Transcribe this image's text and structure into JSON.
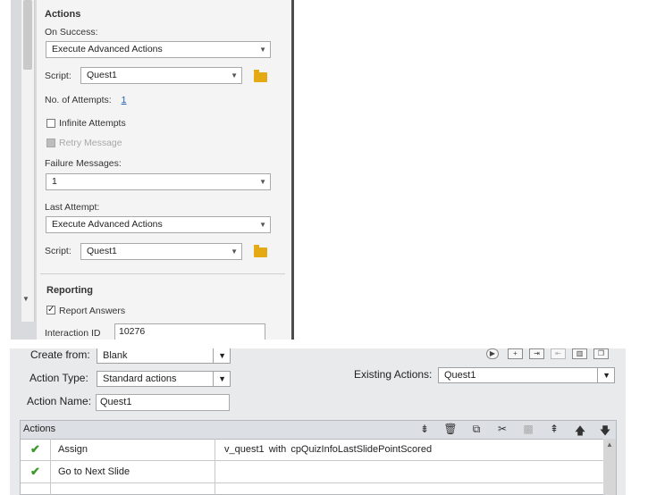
{
  "props": {
    "actions_title": "Actions",
    "on_success_label": "On Success:",
    "on_success_value": "Execute Advanced Actions",
    "script_label": "Script:",
    "script_value": "Quest1",
    "attempts_label": "No. of Attempts:",
    "attempts_value": "1",
    "infinite_label": "Infinite Attempts",
    "retry_label": "Retry Message",
    "failure_label": "Failure Messages:",
    "failure_value": "1",
    "last_attempt_label": "Last Attempt:",
    "last_attempt_value": "Execute Advanced Actions",
    "script2_label": "Script:",
    "script2_value": "Quest1",
    "reporting_title": "Reporting",
    "report_answers_label": "Report Answers",
    "interaction_label": "Interaction ID",
    "interaction_value": "10276"
  },
  "dialog": {
    "create_from_label": "Create from:",
    "create_from_value": "Blank",
    "action_type_label": "Action Type:",
    "action_type_value": "Standard actions",
    "action_name_label": "Action Name:",
    "action_name_value": "Quest1",
    "existing_label": "Existing Actions:",
    "existing_value": "Quest1",
    "grid_title": "Actions",
    "rows": [
      {
        "action": "Assign",
        "detail": "v_quest1   with   cpQuizInfoLastSlidePointScored"
      },
      {
        "action": "Go to Next Slide",
        "detail": ""
      },
      {
        "action": "",
        "detail": ""
      }
    ]
  },
  "colors": {
    "check": "#3a9a2a",
    "folder": "#e5a914",
    "link": "#1f5fa8"
  }
}
